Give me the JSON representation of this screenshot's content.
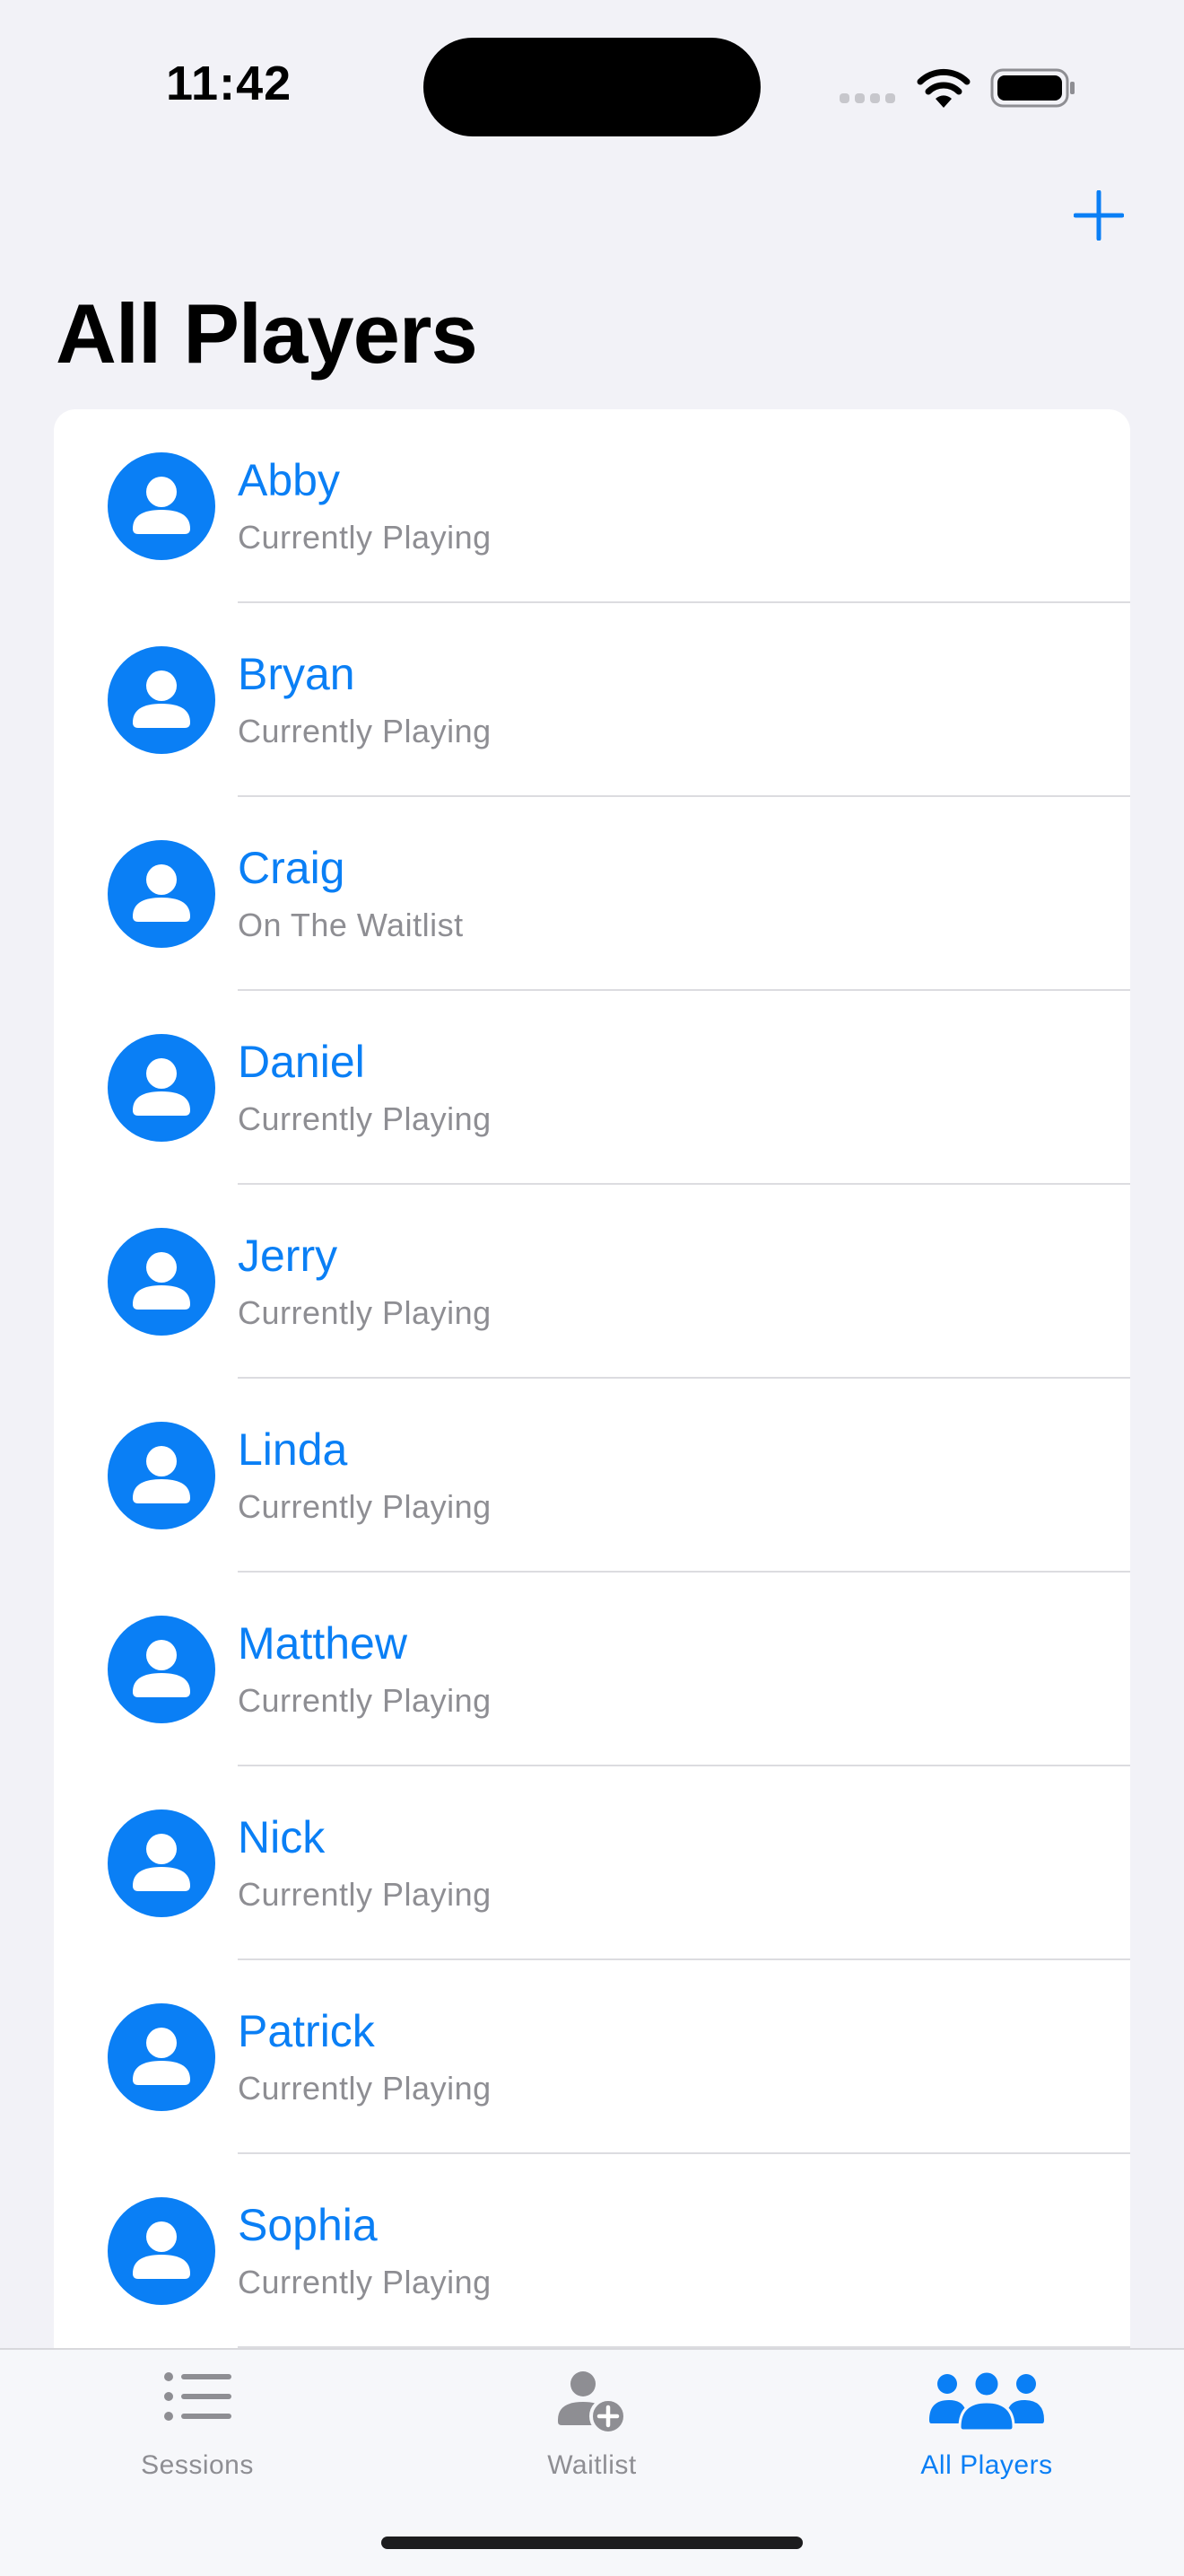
{
  "status_bar": {
    "time": "11:42"
  },
  "nav": {
    "title": "All Players",
    "add_icon": "plus-icon"
  },
  "players": [
    {
      "name": "Abby",
      "status": "Currently Playing"
    },
    {
      "name": "Bryan",
      "status": "Currently Playing"
    },
    {
      "name": "Craig",
      "status": "On The Waitlist"
    },
    {
      "name": "Daniel",
      "status": "Currently Playing"
    },
    {
      "name": "Jerry",
      "status": "Currently Playing"
    },
    {
      "name": "Linda",
      "status": "Currently Playing"
    },
    {
      "name": "Matthew",
      "status": "Currently Playing"
    },
    {
      "name": "Nick",
      "status": "Currently Playing"
    },
    {
      "name": "Patrick",
      "status": "Currently Playing"
    },
    {
      "name": "Sophia",
      "status": "Currently Playing"
    }
  ],
  "tabs": [
    {
      "label": "Sessions",
      "icon": "list-bullet-icon",
      "selected": false
    },
    {
      "label": "Waitlist",
      "icon": "person-add-icon",
      "selected": false
    },
    {
      "label": "All Players",
      "icon": "person-group-icon",
      "selected": true
    }
  ],
  "colors": {
    "accent": "#0a7ff5",
    "background": "#f2f2f7",
    "secondary_text": "#8e8e93",
    "inactive_tab": "#8e8e93"
  }
}
